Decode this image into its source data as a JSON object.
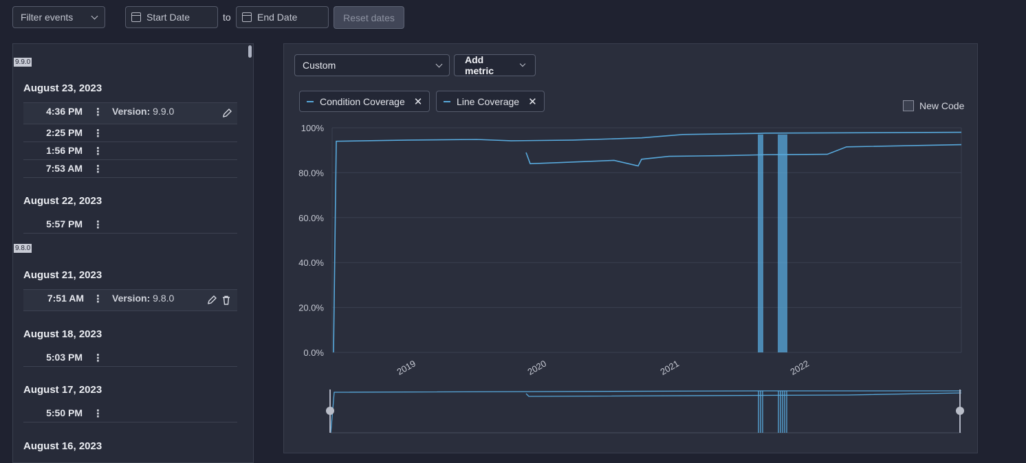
{
  "filters": {
    "filter_events": "Filter events",
    "start_date": "Start Date",
    "to": "to",
    "end_date": "End Date",
    "reset": "Reset dates"
  },
  "versions": [
    {
      "label": "9.9.0"
    },
    {
      "label": "9.8.0"
    }
  ],
  "days": [
    {
      "date": "August 23, 2023",
      "events": [
        {
          "time": "4:36 PM",
          "version_label": "Version:",
          "version": "9.9.0"
        },
        {
          "time": "2:25 PM"
        },
        {
          "time": "1:56 PM"
        },
        {
          "time": "7:53 AM"
        }
      ]
    },
    {
      "date": "August 22, 2023",
      "events": [
        {
          "time": "5:57 PM"
        }
      ]
    },
    {
      "date": "August 21, 2023",
      "events": [
        {
          "time": "7:51 AM",
          "version_label": "Version:",
          "version": "9.8.0"
        }
      ]
    },
    {
      "date": "August 18, 2023",
      "events": [
        {
          "time": "5:03 PM"
        }
      ]
    },
    {
      "date": "August 17, 2023",
      "events": [
        {
          "time": "5:50 PM"
        }
      ]
    },
    {
      "date": "August 16, 2023",
      "events": []
    }
  ],
  "chart_panel": {
    "metric_select": "Custom",
    "add_metric": "Add metric",
    "tags": [
      "Condition Coverage",
      "Line Coverage"
    ],
    "new_code": "New Code",
    "line_color": "#58a9dc"
  },
  "chart_data": {
    "type": "line",
    "ylim": [
      0,
      100
    ],
    "yticks": [
      "100%",
      "80.0%",
      "60.0%",
      "40.0%",
      "20.0%",
      "0.0%"
    ],
    "xticks": [
      "2019",
      "2020",
      "2021",
      "2022"
    ],
    "series": [
      {
        "name": "Condition Coverage",
        "values": [
          0,
          94,
          94.5,
          94.8,
          94.2,
          94.5,
          95.5,
          97,
          97.5,
          97.6,
          97.8,
          98
        ]
      },
      {
        "name": "Line Coverage",
        "values": [
          89,
          84,
          84.5,
          85.5,
          83,
          86,
          87.3,
          87.6,
          88,
          88.2,
          91.5,
          92.5
        ]
      }
    ]
  }
}
